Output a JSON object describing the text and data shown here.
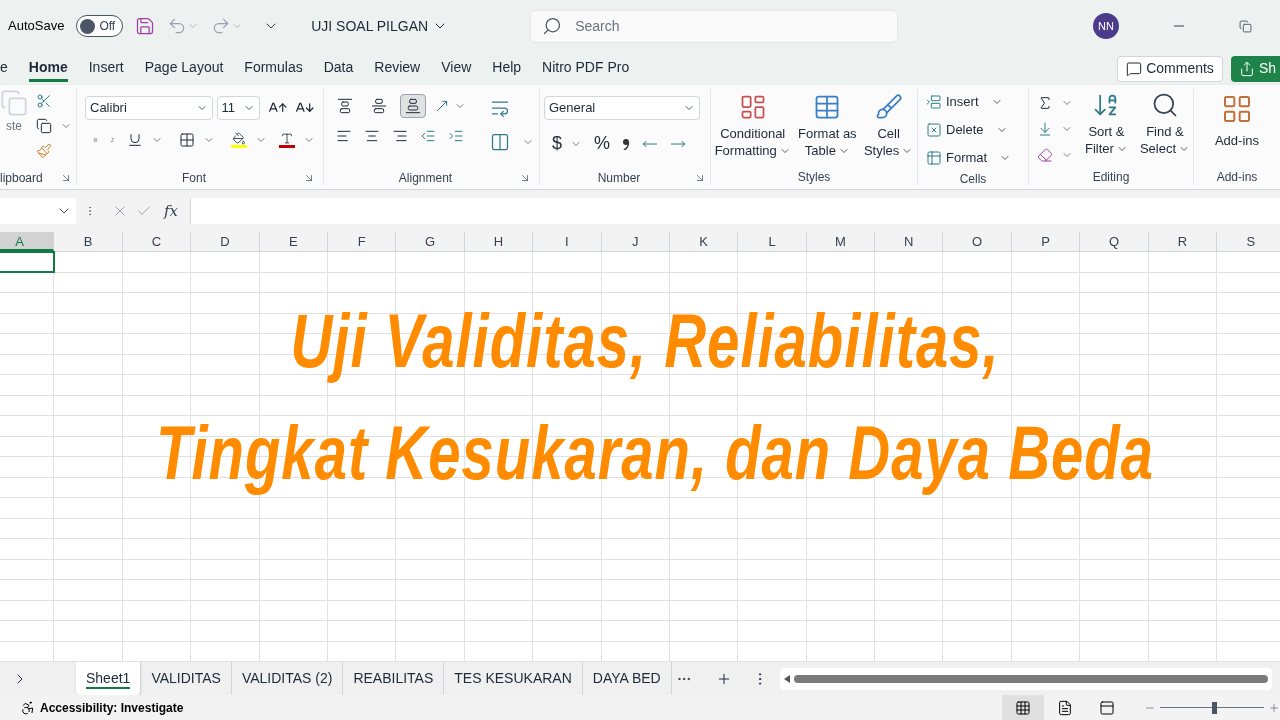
{
  "title_bar": {
    "autosave_label": "AutoSave",
    "autosave": {
      "on": false,
      "label": "Off"
    },
    "file_name": "UJI SOAL PILGAN",
    "search": {
      "placeholder": "Search"
    },
    "user_initials": "NN"
  },
  "ribbon_tabs": [
    {
      "label": "e",
      "selected": false
    },
    {
      "label": "Home",
      "selected": true
    },
    {
      "label": "Insert",
      "selected": false
    },
    {
      "label": "Page Layout",
      "selected": false
    },
    {
      "label": "Formulas",
      "selected": false
    },
    {
      "label": "Data",
      "selected": false
    },
    {
      "label": "Review",
      "selected": false
    },
    {
      "label": "View",
      "selected": false
    },
    {
      "label": "Help",
      "selected": false
    },
    {
      "label": "Nitro PDF Pro",
      "selected": false
    }
  ],
  "comments_button": "Comments",
  "share_button": "Sh",
  "ribbon": {
    "clipboard": {
      "paste_label": "ste",
      "group_label": "lipboard"
    },
    "font": {
      "font_name": "Calibri",
      "font_size": "11",
      "group_label": "Font"
    },
    "alignment": {
      "group_label": "Alignment",
      "vertical": [
        {
          "kind": "top",
          "selected": false
        },
        {
          "kind": "middle",
          "selected": false
        },
        {
          "kind": "bottom",
          "selected": true
        }
      ]
    },
    "number": {
      "format": "General",
      "currency": "$",
      "percent": "%",
      "group_label": "Number"
    },
    "styles": {
      "buttons": [
        {
          "kind": "conditional",
          "lines": [
            "Conditional",
            "Formatting"
          ]
        },
        {
          "kind": "table",
          "lines": [
            "Format as",
            "Table"
          ]
        },
        {
          "kind": "cell",
          "lines": [
            "Cell",
            "Styles"
          ]
        }
      ],
      "group_label": "Styles"
    },
    "cells": {
      "buttons": [
        {
          "kind": "insert",
          "label": "Insert"
        },
        {
          "kind": "delete",
          "label": "Delete"
        },
        {
          "kind": "format",
          "label": "Format"
        }
      ],
      "group_label": "Cells"
    },
    "editing": {
      "buttons": [
        {
          "kind": "sort",
          "lines": [
            "Sort &",
            "Filter"
          ]
        },
        {
          "kind": "find",
          "lines": [
            "Find &",
            "Select"
          ]
        }
      ],
      "group_label": "Editing"
    },
    "add_ins": {
      "button": "Add-ins",
      "group_label": "Add-ins"
    }
  },
  "formula_bar": {
    "function_label": "fx"
  },
  "columns": [
    {
      "label": "A",
      "selected": true
    },
    {
      "label": "B",
      "selected": false
    },
    {
      "label": "C",
      "selected": false
    },
    {
      "label": "D",
      "selected": false
    },
    {
      "label": "E",
      "selected": false
    },
    {
      "label": "F",
      "selected": false
    },
    {
      "label": "G",
      "selected": false
    },
    {
      "label": "H",
      "selected": false
    },
    {
      "label": "I",
      "selected": false
    },
    {
      "label": "J",
      "selected": false
    },
    {
      "label": "K",
      "selected": false
    },
    {
      "label": "L",
      "selected": false
    },
    {
      "label": "M",
      "selected": false
    },
    {
      "label": "N",
      "selected": false
    },
    {
      "label": "O",
      "selected": false
    },
    {
      "label": "P",
      "selected": false
    },
    {
      "label": "Q",
      "selected": false
    },
    {
      "label": "R",
      "selected": false
    },
    {
      "label": "S",
      "selected": false
    }
  ],
  "headline": [
    "Uji Validitas, Reliabilitas,",
    "Tingkat Kesukaran, dan Daya Beda"
  ],
  "sheet_tabs": [
    {
      "label": "Sheet1",
      "selected": true
    },
    {
      "label": "VALIDITAS",
      "selected": false
    },
    {
      "label": "VALIDITAS (2)",
      "selected": false
    },
    {
      "label": "REABILITAS",
      "selected": false
    },
    {
      "label": "TES KESUKARAN",
      "selected": false
    },
    {
      "label": "DAYA BED",
      "selected": false
    }
  ],
  "status_bar": {
    "accessibility": "Accessibility: Investigate",
    "views": [
      {
        "kind": "normal",
        "selected": true
      },
      {
        "kind": "page_layout",
        "selected": false
      },
      {
        "kind": "page_break",
        "selected": false
      }
    ],
    "zoom": {
      "level": 0.52
    }
  }
}
